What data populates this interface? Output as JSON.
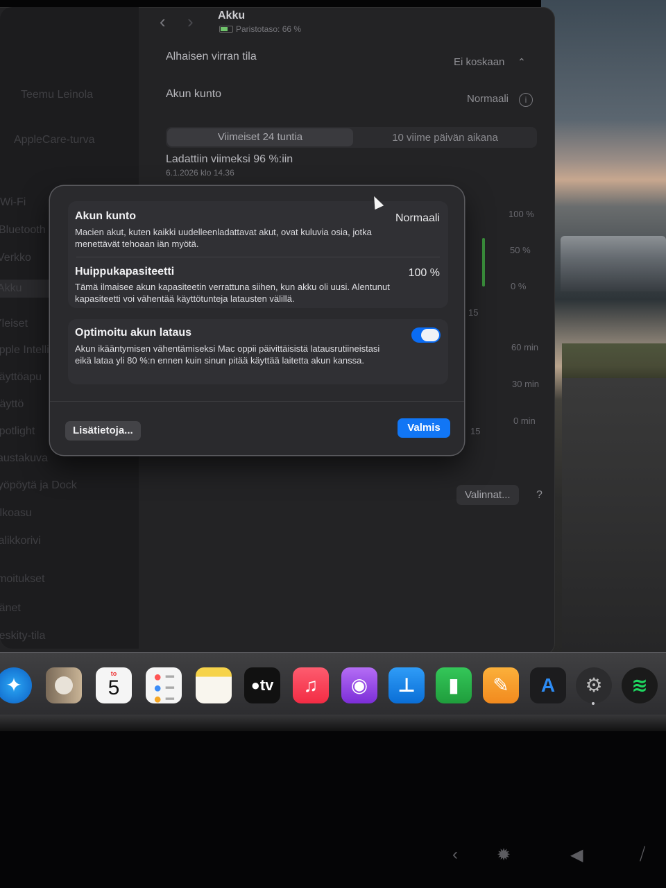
{
  "window": {
    "title": "Akku",
    "subtitle": "Paristotaso: 66 %"
  },
  "sidebar": {
    "items": [
      "Teemu Leinola",
      "AppleCare-turva",
      "Wi-Fi",
      "Bluetooth",
      "Verkko",
      "Akku",
      "Yleiset",
      "Apple Intelligence",
      "Käyttöapu",
      "Näyttö",
      "Spotlight",
      "Taustakuva",
      "Työpöytä ja Dock",
      "Ulkoasu",
      "Valikkorivi",
      "Ilmoitukset",
      "Äänet",
      "Keskity-tila"
    ]
  },
  "settings": {
    "low_power_label": "Alhaisen virran tila",
    "low_power_value": "Ei koskaan",
    "health_label": "Akun kunto",
    "health_value": "Normaali",
    "tab_24h": "Viimeiset 24 tuntia",
    "tab_10d": "10 viime päivän aikana",
    "last_charged": "Ladattiin viimeksi 96 %:iin",
    "last_charged_date": "6.1.2026 klo 14.36",
    "axis_pct": [
      "100 %",
      "50 %",
      "0 %"
    ],
    "axis_min": [
      "60 min",
      "30 min",
      "0 min"
    ],
    "axis_tick_a": "15",
    "axis_tick_b": "15",
    "options_button": "Valinnat...",
    "help_button": "?"
  },
  "dialog": {
    "health_title": "Akun kunto",
    "health_value": "Normaali",
    "health_desc": "Macien akut, kuten kaikki uudelleenladattavat akut, ovat kuluvia osia, jotka menettävät tehoaan iän myötä.",
    "capacity_title": "Huippukapasiteetti",
    "capacity_value": "100 %",
    "capacity_desc": "Tämä ilmaisee akun kapasiteetin verrattuna siihen, kun akku oli uusi. Alentunut kapasiteetti voi vähentää käyttötunteja latausten välillä.",
    "optimized_title": "Optimoitu akun lataus",
    "optimized_desc": "Akun ikääntymisen vähentämiseksi Mac oppii päivittäisistä latausrutiineistasi eikä lataa yli 80 %:n ennen kuin sinun pitää käyttää laitetta akun kanssa.",
    "optimized_enabled": true,
    "more_button": "Lisätietoja...",
    "done_button": "Valmis"
  },
  "dock": {
    "calendar_month": "to",
    "calendar_day": "5",
    "tv_label": "tv",
    "icons": [
      "safari-icon",
      "contacts-icon",
      "calendar-icon",
      "reminders-icon",
      "notes-icon",
      "apple-tv-icon",
      "music-icon",
      "podcasts-icon",
      "keynote-icon",
      "numbers-icon",
      "pages-icon",
      "app-store-icon",
      "system-settings-icon",
      "spotify-icon"
    ]
  },
  "colors": {
    "accent": "#1176f5",
    "toggle_on": "#0a6cf4",
    "status_green": "#2ac640"
  }
}
